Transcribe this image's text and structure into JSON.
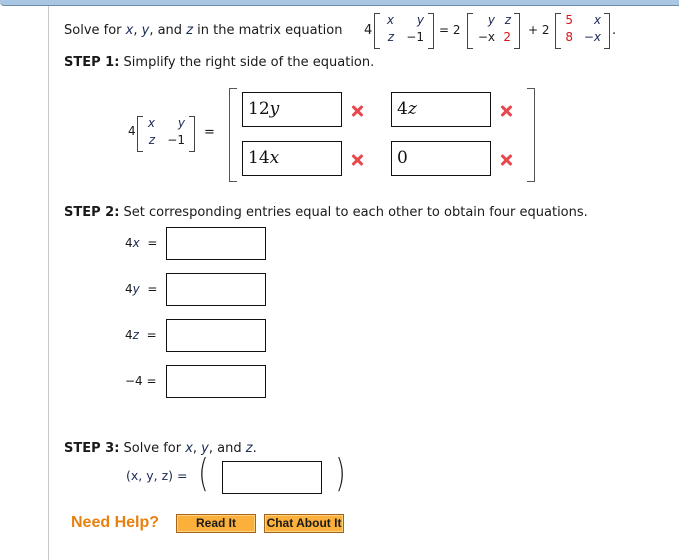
{
  "prompt": {
    "prefix": "Solve for ",
    "vars": [
      "x",
      "y",
      "z"
    ],
    "sep1": ", ",
    "sep2": ", and ",
    "suffix": " in the matrix equation",
    "lhs_scalar": "4",
    "lhs_matrix": [
      [
        "x",
        "y"
      ],
      [
        "z",
        "−1"
      ]
    ],
    "eq": "= 2",
    "rhs1_matrix": [
      [
        "y",
        "z"
      ],
      [
        "−x",
        "2"
      ]
    ],
    "plus": "+ 2",
    "rhs2_matrix": [
      [
        "5",
        "x"
      ],
      [
        "8",
        "−x"
      ]
    ],
    "period": "."
  },
  "step1": {
    "label": "STEP 1:",
    "text": " Simplify the right side of the equation.",
    "lhs_scalar": "4",
    "lhs_matrix": [
      [
        "x",
        "y"
      ],
      [
        "z",
        "−1"
      ]
    ],
    "equals": "=",
    "answers": [
      {
        "value": "12y",
        "status": "incorrect"
      },
      {
        "value": "4z",
        "status": "incorrect"
      },
      {
        "value": "14x",
        "status": "incorrect"
      },
      {
        "value": "0",
        "status": "incorrect"
      }
    ],
    "status_color": "#e8474d"
  },
  "step2": {
    "label": "STEP 2:",
    "text": " Set corresponding entries equal to each other to obtain four equations.",
    "equations": [
      {
        "lhs_num": "4",
        "lhs_var": "x",
        "eq": "=",
        "value": ""
      },
      {
        "lhs_num": "4",
        "lhs_var": "y",
        "eq": "=",
        "value": ""
      },
      {
        "lhs_num": "4",
        "lhs_var": "z",
        "eq": "=",
        "value": ""
      },
      {
        "lhs_num": "−4",
        "lhs_var": "",
        "eq": "=",
        "value": ""
      }
    ]
  },
  "step3": {
    "label": "STEP 3:",
    "text_prefix": " Solve for ",
    "vars": [
      "x",
      "y",
      "z"
    ],
    "sep1": ", ",
    "sep2": ", and ",
    "period": ".",
    "tuple_label": "(x, y, z) =",
    "answer": ""
  },
  "help": {
    "label": "Need Help?",
    "read_it": "Read It",
    "chat": "Chat About It",
    "accent": "#e8800f"
  }
}
